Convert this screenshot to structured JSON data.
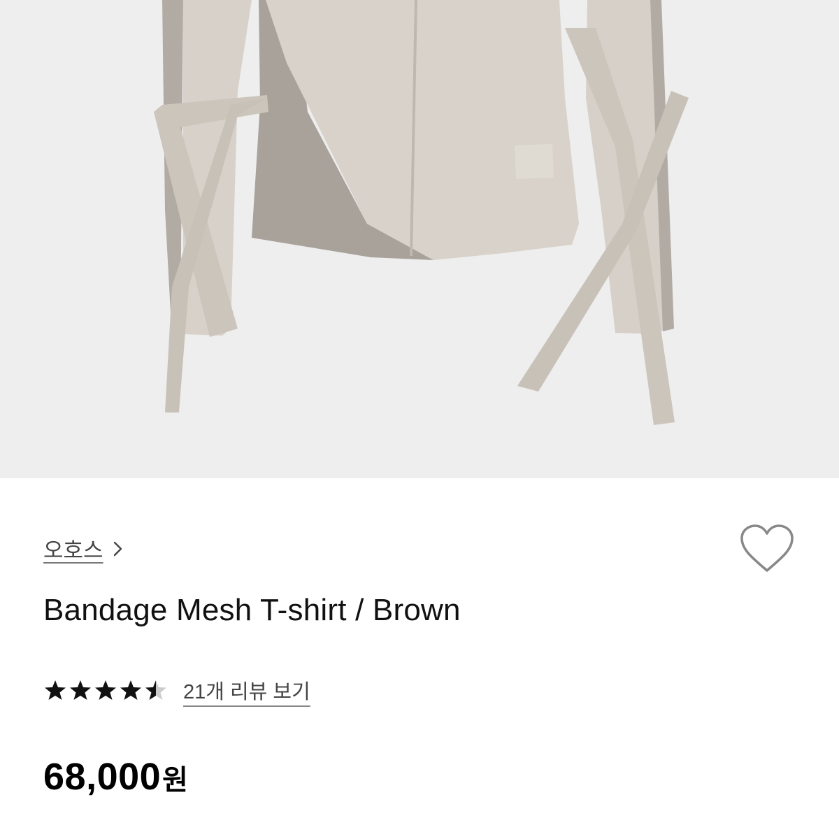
{
  "product": {
    "image_alt": "Bandage Mesh T-shirt / Brown product photo",
    "brand": "오호스",
    "title": "Bandage Mesh T-shirt / Brown",
    "rating": 4.5,
    "rating_max": 5,
    "review_link": "21개 리뷰 보기",
    "price_value": "68,000",
    "price_unit": "원"
  },
  "icons": {
    "brand_chevron": "chevron-right-icon",
    "wishlist": "heart-outline-icon",
    "star": "star-icon"
  },
  "colors": {
    "image_bg": "#eeeeee",
    "garment_light": "#d6d0c8",
    "garment_dark": "#aaa39c",
    "star_fill": "#111111",
    "star_empty": "#cccccc"
  }
}
